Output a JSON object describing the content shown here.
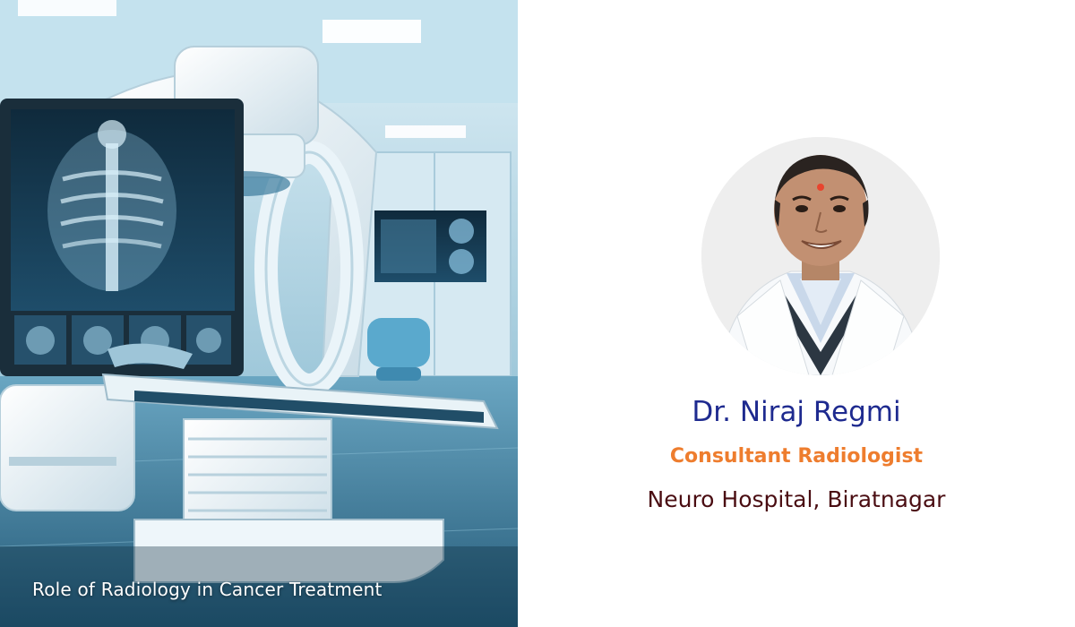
{
  "hero": {
    "caption": "Role of Radiology in Cancer Treatment",
    "image_subject": "radiology-room-illustration"
  },
  "doctor": {
    "name": "Dr. Niraj Regmi",
    "title": "Consultant Radiologist",
    "hospital": "Neuro Hospital, Biratnagar",
    "photo": "doctor-portrait"
  },
  "colors": {
    "name": "#1e2a8f",
    "title": "#ee7d2e",
    "hospital": "#4a0d12",
    "caption": "#ffffff",
    "background": "#ffffff"
  }
}
